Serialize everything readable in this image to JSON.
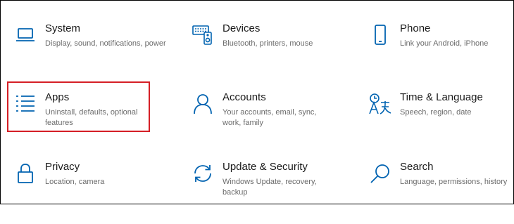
{
  "settings": {
    "tiles": [
      {
        "icon": "laptop-icon",
        "title": "System",
        "desc": "Display, sound, notifications, power"
      },
      {
        "icon": "devices-icon",
        "title": "Devices",
        "desc": "Bluetooth, printers, mouse"
      },
      {
        "icon": "phone-icon",
        "title": "Phone",
        "desc": "Link your Android, iPhone"
      },
      {
        "icon": "apps-icon",
        "title": "Apps",
        "desc": "Uninstall, defaults, optional features"
      },
      {
        "icon": "person-icon",
        "title": "Accounts",
        "desc": "Your accounts, email, sync, work, family"
      },
      {
        "icon": "time-language-icon",
        "title": "Time & Language",
        "desc": "Speech, region, date"
      },
      {
        "icon": "lock-icon",
        "title": "Privacy",
        "desc": "Location, camera"
      },
      {
        "icon": "sync-arrows-icon",
        "title": "Update & Security",
        "desc": "Windows Update, recovery, backup"
      },
      {
        "icon": "search-icon",
        "title": "Search",
        "desc": "Language, permissions, history"
      }
    ]
  },
  "colors": {
    "accent": "#0063b1",
    "highlight": "#d51f26",
    "title": "#1a1a1a",
    "description": "#6b6b6b"
  }
}
